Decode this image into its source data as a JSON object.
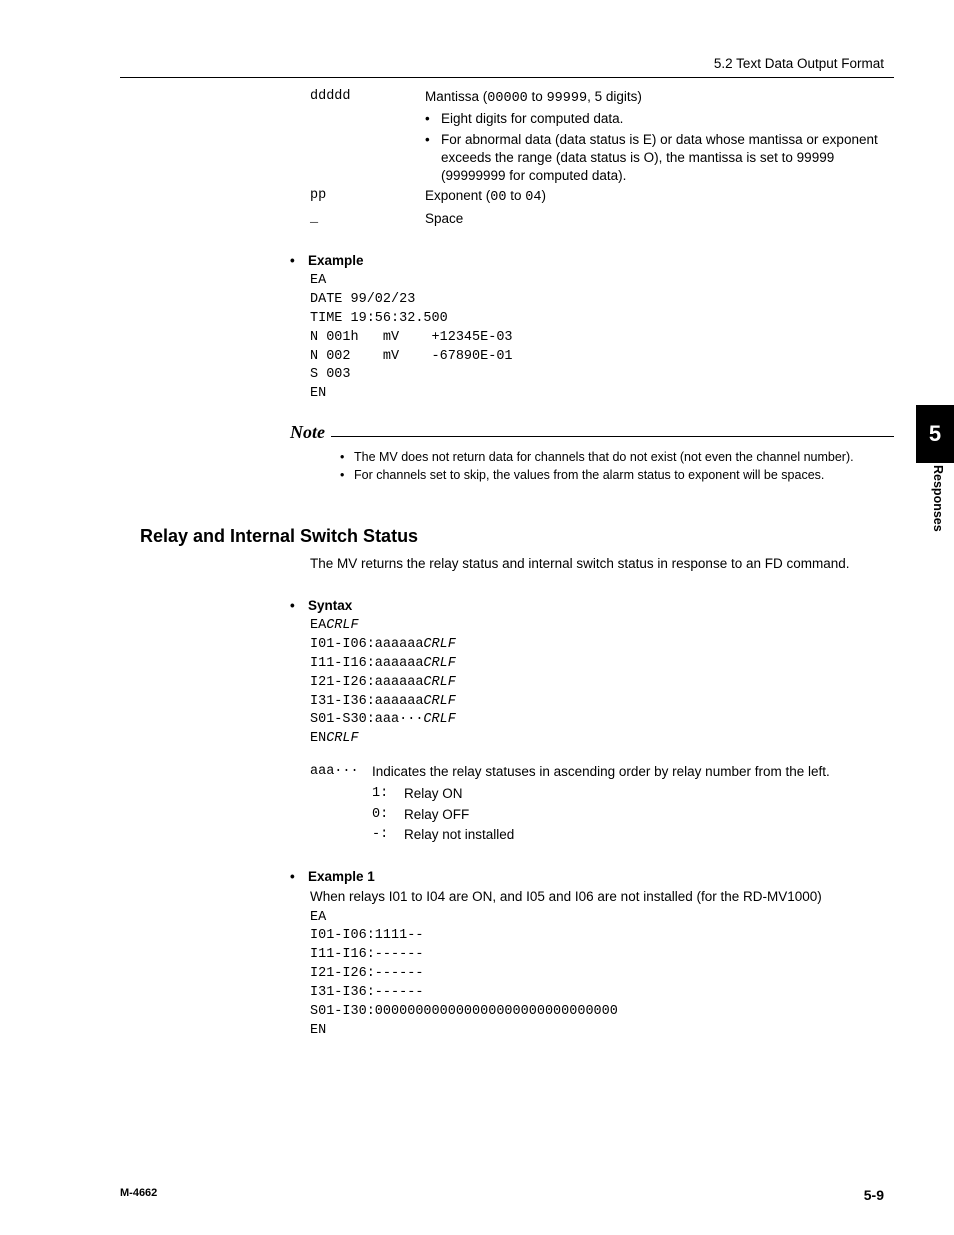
{
  "header": {
    "section": "5.2  Text Data Output Format"
  },
  "content": {
    "defs": {
      "ddddd": {
        "key": "ddddd",
        "text_pre": "Mantissa (",
        "code1": "00000",
        "mid": " to ",
        "code2": "99999",
        "text_post": ", 5 digits)",
        "b1": "Eight digits for computed data.",
        "b2": "For abnormal data (data status is E) or data whose mantissa or exponent exceeds the range (data status is O), the mantissa is set to 99999 (99999999 for computed data)."
      },
      "pp": {
        "key": "pp",
        "text_pre": "Exponent (",
        "code1": "00",
        "mid": " to ",
        "code2": "04",
        "text_post": ")"
      },
      "space": {
        "key": "_",
        "text": "Space"
      }
    },
    "example1": {
      "title": "Example",
      "code": "EA\nDATE 99/02/23\nTIME 19:56:32.500\nN 001h   mV    +12345E-03\nN 002    mV    -67890E-01\nS 003\nEN"
    },
    "note": {
      "title": "Note",
      "items": {
        "n1": "The MV does not return data for channels that do not exist (not even the channel number).",
        "n2": "For channels set to skip, the values from the alarm status to exponent will be spaces."
      }
    },
    "relay": {
      "title": "Relay and Internal Switch Status",
      "para": "The MV returns the relay status and internal switch status in response to an FD command.",
      "syntax": {
        "title": "Syntax",
        "l1a": "EA",
        "l1b": "CRLF",
        "l2a": "I01-I06:aaaaaa",
        "l2b": "CRLF",
        "l3a": "I11-I16:aaaaaa",
        "l3b": "CRLF",
        "l4a": "I21-I26:aaaaaa",
        "l4b": "CRLF",
        "l5a": "I31-I36:aaaaaa",
        "l5b": "CRLF",
        "l6a": "S01-S30:aaa···",
        "l6b": "CRLF",
        "l7a": "EN",
        "l7b": "CRLF"
      },
      "aaa": {
        "key": "aaa···",
        "text": "Indicates the relay statuses in ascending order by relay number from the left.",
        "r1k": "1:",
        "r1v": "Relay ON",
        "r2k": "0:",
        "r2v": "Relay OFF",
        "r3k": "-:",
        "r3v": "Relay not installed"
      },
      "example": {
        "title": "Example 1",
        "para": "When relays I01 to I04 are ON, and I05 and I06 are not installed (for the RD-MV1000)",
        "code": "EA\nI01-I06:1111--\nI11-I16:------\nI21-I26:------\nI31-I36:------\nS01-I30:000000000000000000000000000000\nEN"
      }
    }
  },
  "sidebar": {
    "num": "5",
    "label": "Responses"
  },
  "footer": {
    "left": "M-4662",
    "right": "5-9"
  }
}
